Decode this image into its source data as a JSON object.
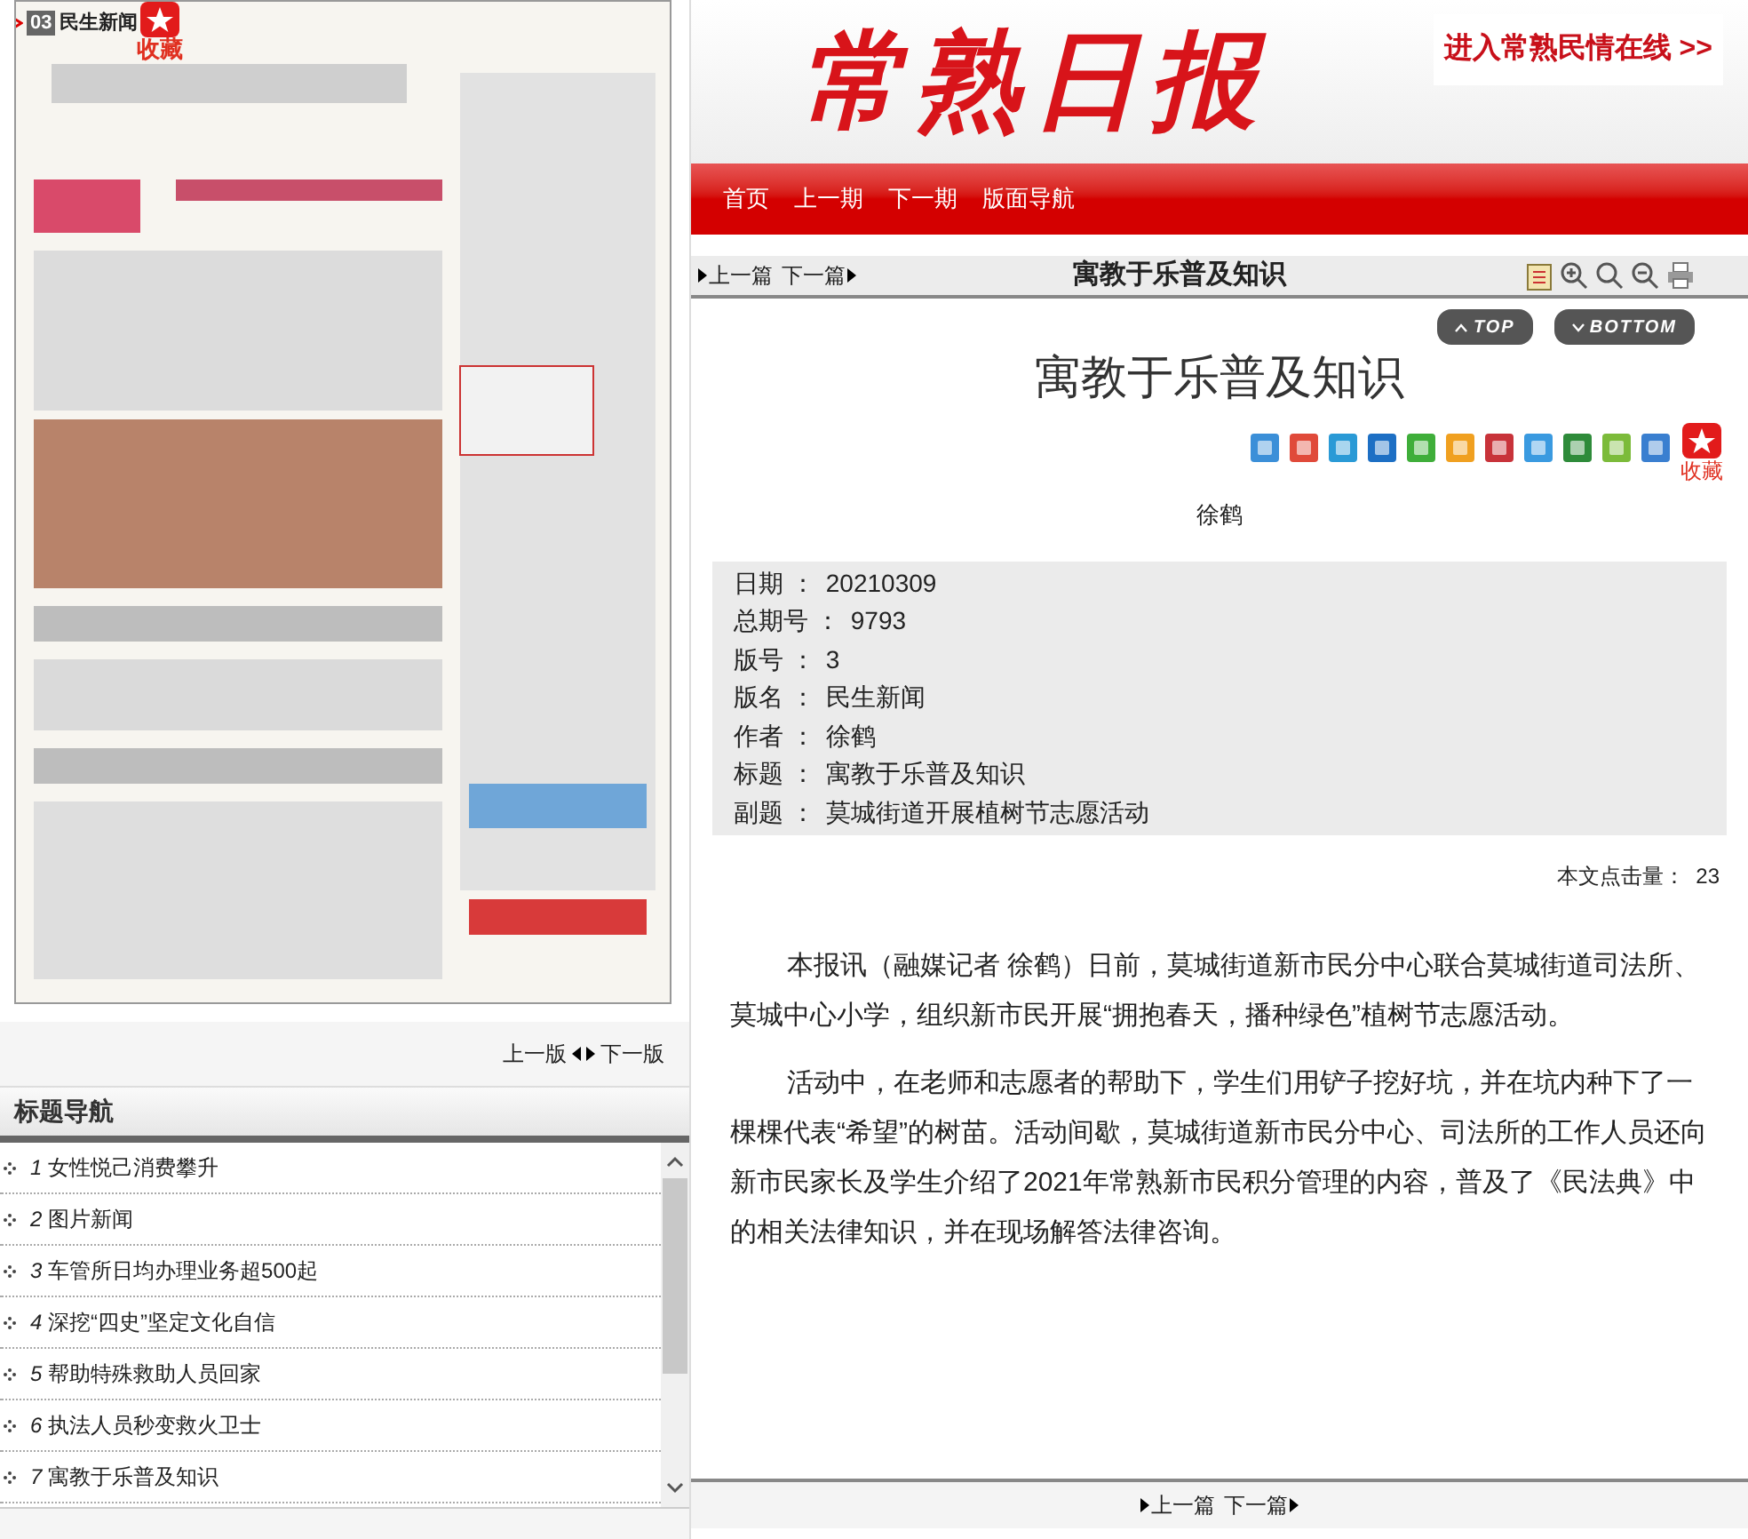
{
  "page_scan": {
    "page_number": "03",
    "section": "民生新闻",
    "favorite_label": "收藏"
  },
  "page_nav": {
    "prev": "上一版",
    "next": "下一版"
  },
  "title_nav": {
    "heading": "标题导航",
    "items": [
      {
        "number": "1",
        "title": "女性悦己消费攀升"
      },
      {
        "number": "2",
        "title": "图片新闻"
      },
      {
        "number": "3",
        "title": "车管所日均办理业务超500起"
      },
      {
        "number": "4",
        "title": "深挖“四史”坚定文化自信"
      },
      {
        "number": "5",
        "title": "帮助特殊救助人员回家"
      },
      {
        "number": "6",
        "title": "执法人员秒变救火卫士"
      },
      {
        "number": "7",
        "title": "寓教于乐普及知识"
      }
    ]
  },
  "header": {
    "logo": "常熟日报",
    "promo_link": "进入常熟民情在线 >>"
  },
  "menu": [
    "首页",
    "上一期",
    "下一期",
    "版面导航"
  ],
  "toolbar": {
    "prev": "上一篇",
    "next": "下一篇",
    "title": "寓教于乐普及知识"
  },
  "scroll_buttons": [
    "TOP",
    "BOTTOM"
  ],
  "article": {
    "title": "寓教于乐普及知识",
    "favorite_label": "收藏",
    "author": "徐鹤",
    "info": [
      {
        "label": "日期 ：",
        "value": "20210309"
      },
      {
        "label": "总期号 ：",
        "value": "9793"
      },
      {
        "label": "版号 ：",
        "value": "3"
      },
      {
        "label": "版名 ：",
        "value": "民生新闻"
      },
      {
        "label": "作者 ：",
        "value": "徐鹤"
      },
      {
        "label": "标题 ：",
        "value": "寓教于乐普及知识"
      },
      {
        "label": "副题 ：",
        "value": "莫城街道开展植树节志愿活动"
      }
    ],
    "hits_label": "本文点击量：",
    "hits": "23",
    "paragraphs": [
      "本报讯（融媒记者 徐鹤）日前，莫城街道新市民分中心联合莫城街道司法所、莫城中心小学，组织新市民开展“拥抱春天，播种绿色”植树节志愿活动。",
      "活动中，在老师和志愿者的帮助下，学生们用铲子挖好坑，并在坑内种下了一棵棵代表“希望”的树苗。活动间歇，莫城街道新市民分中心、司法所的工作人员还向新市民家长及学生介绍了2021年常熟新市民积分管理的内容，普及了《民法典》中的相关法律知识，并在现场解答法律咨询。"
    ]
  },
  "bottom_nav": {
    "prev": "上一篇",
    "next": "下一篇"
  }
}
